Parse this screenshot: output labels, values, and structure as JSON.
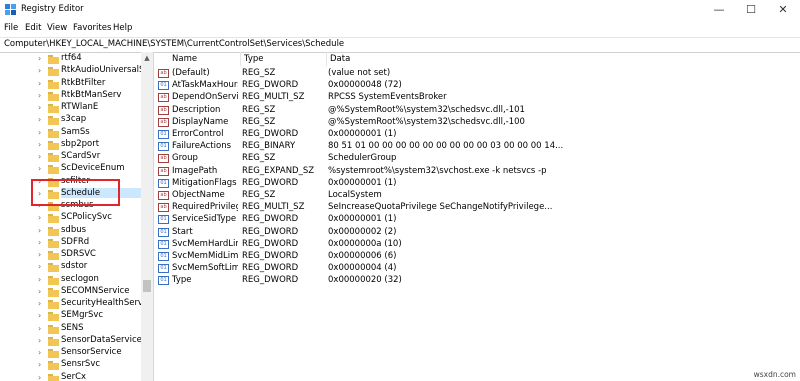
{
  "window": {
    "title": "Registry Editor",
    "controls": {
      "minimize": "—",
      "maximize": "☐",
      "close": "✕"
    }
  },
  "menu": [
    "File",
    "Edit",
    "View",
    "Favorites",
    "Help"
  ],
  "address": "Computer\\HKEY_LOCAL_MACHINE\\SYSTEM\\CurrentControlSet\\Services\\Schedule",
  "tree": {
    "items": [
      {
        "label": "rtf64"
      },
      {
        "label": "RtkAudioUniversalSer"
      },
      {
        "label": "RtkBtFilter"
      },
      {
        "label": "RtkBtManServ"
      },
      {
        "label": "RTWlanE"
      },
      {
        "label": "s3cap"
      },
      {
        "label": "SamSs"
      },
      {
        "label": "sbp2port"
      },
      {
        "label": "SCardSvr"
      },
      {
        "label": "ScDeviceEnum"
      },
      {
        "label": "scfilter"
      },
      {
        "label": "Schedule"
      },
      {
        "label": "scmbus"
      },
      {
        "label": "SCPolicySvc"
      },
      {
        "label": "sdbus"
      },
      {
        "label": "SDFRd"
      },
      {
        "label": "SDRSVC"
      },
      {
        "label": "sdstor"
      },
      {
        "label": "seclogon"
      },
      {
        "label": "SECOMNService"
      },
      {
        "label": "SecurityHealthService"
      },
      {
        "label": "SEMgrSvc"
      },
      {
        "label": "SENS"
      },
      {
        "label": "SensorDataService"
      },
      {
        "label": "SensorService"
      },
      {
        "label": "SensrSvc"
      },
      {
        "label": "SerCx"
      }
    ],
    "selected": "Schedule"
  },
  "list": {
    "headers": {
      "name": "Name",
      "type": "Type",
      "data": "Data"
    },
    "rows": [
      {
        "name": "(Default)",
        "type": "REG_SZ",
        "data": "(value not set)",
        "icon": "ab"
      },
      {
        "name": "AtTaskMaxHours",
        "type": "REG_DWORD",
        "data": "0x00000048 (72)",
        "icon": "bin"
      },
      {
        "name": "DependOnService",
        "type": "REG_MULTI_SZ",
        "data": "RPCSS SystemEventsBroker",
        "icon": "ab"
      },
      {
        "name": "Description",
        "type": "REG_SZ",
        "data": "@%SystemRoot%\\system32\\schedsvc.dll,-101",
        "icon": "ab"
      },
      {
        "name": "DisplayName",
        "type": "REG_SZ",
        "data": "@%SystemRoot%\\system32\\schedsvc.dll,-100",
        "icon": "ab"
      },
      {
        "name": "ErrorControl",
        "type": "REG_DWORD",
        "data": "0x00000001 (1)",
        "icon": "bin"
      },
      {
        "name": "FailureActions",
        "type": "REG_BINARY",
        "data": "80 51 01 00 00 00 00 00 00 00 00 00 03 00 00 00 14...",
        "icon": "bin"
      },
      {
        "name": "Group",
        "type": "REG_SZ",
        "data": "SchedulerGroup",
        "icon": "ab"
      },
      {
        "name": "ImagePath",
        "type": "REG_EXPAND_SZ",
        "data": "%systemroot%\\system32\\svchost.exe -k netsvcs -p",
        "icon": "ab"
      },
      {
        "name": "MitigationFlags",
        "type": "REG_DWORD",
        "data": "0x00000001 (1)",
        "icon": "bin"
      },
      {
        "name": "ObjectName",
        "type": "REG_SZ",
        "data": "LocalSystem",
        "icon": "ab"
      },
      {
        "name": "RequiredPrivileg...",
        "type": "REG_MULTI_SZ",
        "data": "SeIncreaseQuotaPrivilege SeChangeNotifyPrivilege...",
        "icon": "ab"
      },
      {
        "name": "ServiceSidType",
        "type": "REG_DWORD",
        "data": "0x00000001 (1)",
        "icon": "bin"
      },
      {
        "name": "Start",
        "type": "REG_DWORD",
        "data": "0x00000002 (2)",
        "icon": "bin"
      },
      {
        "name": "SvcMemHardLimi...",
        "type": "REG_DWORD",
        "data": "0x0000000a (10)",
        "icon": "bin"
      },
      {
        "name": "SvcMemMidLimi...",
        "type": "REG_DWORD",
        "data": "0x00000006 (6)",
        "icon": "bin"
      },
      {
        "name": "SvcMemSoftLimi...",
        "type": "REG_DWORD",
        "data": "0x00000004 (4)",
        "icon": "bin"
      },
      {
        "name": "Type",
        "type": "REG_DWORD",
        "data": "0x00000020 (32)",
        "icon": "bin"
      }
    ]
  },
  "watermark": "wsxdn.com",
  "colors": {
    "highlight": "#e0262c",
    "folder": "#f1c654",
    "selection": "#cce8ff"
  }
}
